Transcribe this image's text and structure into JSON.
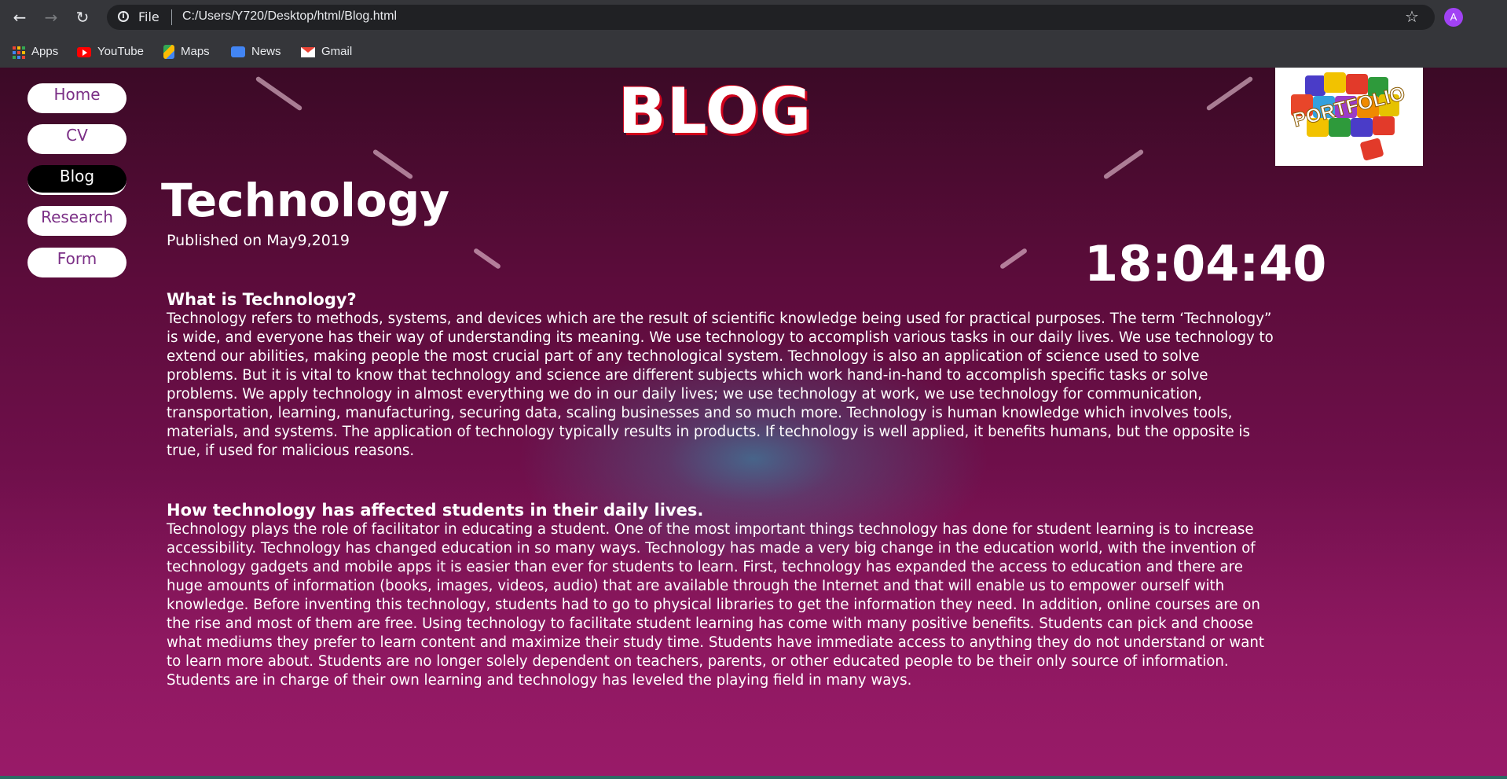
{
  "browser": {
    "address_prefix": "File",
    "url": "C:/Users/Y720/Desktop/html/Blog.html",
    "avatar_letter": "A",
    "bookmarks": [
      "Apps",
      "YouTube",
      "Maps",
      "News",
      "Gmail"
    ]
  },
  "site": {
    "nav": [
      "Home",
      "CV",
      "Blog",
      "Research",
      "Form"
    ],
    "active_nav": "Blog",
    "title": "BLOG",
    "logo_text": "PORTFOLIO",
    "clock": "18:04:40"
  },
  "post": {
    "heading": "Technology",
    "published": "Published on May9,2019",
    "sections": [
      {
        "heading": "What is Technology?",
        "body": "Technology refers to methods, systems, and devices which are the result of scientific knowledge being used for practical purposes. The term ‘Technology” is wide, and everyone has their way of understanding its meaning. We use technology to accomplish various tasks in our daily lives. We use technology to extend our abilities, making people the most crucial part of any technological system. Technology is also an application of science used to solve problems. But it is vital to know that technology and science are different subjects which work hand-in-hand to accomplish specific tasks or solve problems. We apply technology in almost everything we do in our daily lives; we use technology at work, we use technology for communication, transportation, learning, manufacturing, securing data, scaling businesses and so much more. Technology is human knowledge which involves tools, materials, and systems. The application of technology typically results in products. If technology is well applied, it benefits humans, but the opposite is true, if used for malicious reasons."
      },
      {
        "heading": "How technology has affected students in their daily lives.",
        "body": "Technology plays the role of facilitator in educating a student. One of the most important things technology has done for student learning is to increase accessibility. Technology has changed education in so many ways. Technology has made a very big change in the education world, with the invention of technology gadgets and mobile apps it is easier than ever for students to learn. First, technology has expanded the access to education and there are huge amounts of information (books, images, videos, audio) that are available through the Internet and that will enable us to empower ourself with knowledge. Before inventing this technology, students had to go to physical libraries to get the information they need. In addition, online courses are on the rise and most of them are free. Using technology to facilitate student learning has come with many positive benefits. Students can pick and choose what mediums they prefer to learn content and maximize their study time. Students have immediate access to anything they do not understand or want to learn more about. Students are no longer solely dependent on teachers, parents, or other educated people to be their only source of information. Students are in charge of their own learning and technology has leveled the playing field in many ways."
      }
    ]
  }
}
